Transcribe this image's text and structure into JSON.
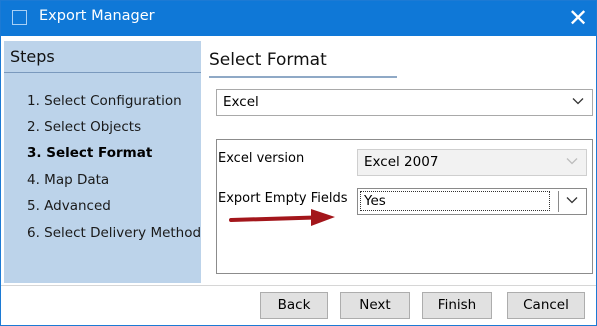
{
  "window": {
    "title": "Export Manager",
    "accent": "#0f78d7"
  },
  "steps": {
    "title": "Steps",
    "items": [
      {
        "label": "1. Select Configuration",
        "active": false
      },
      {
        "label": "2. Select Objects",
        "active": false
      },
      {
        "label": "3. Select Format",
        "active": true
      },
      {
        "label": "4. Map Data",
        "active": false
      },
      {
        "label": "5. Advanced",
        "active": false
      },
      {
        "label": "6. Select Delivery Method",
        "active": false
      }
    ]
  },
  "main": {
    "section_title": "Select Format",
    "format": {
      "value": "Excel"
    },
    "options": {
      "excel_version": {
        "label": "Excel version",
        "value": "Excel 2007",
        "enabled": false
      },
      "export_empty_fields": {
        "label": "Export Empty Fields",
        "value": "Yes",
        "enabled": true
      }
    }
  },
  "buttons": {
    "back": "Back",
    "next": "Next",
    "finish": "Finish",
    "cancel": "Cancel"
  },
  "annotation": {
    "arrow_color": "#a3161b"
  }
}
